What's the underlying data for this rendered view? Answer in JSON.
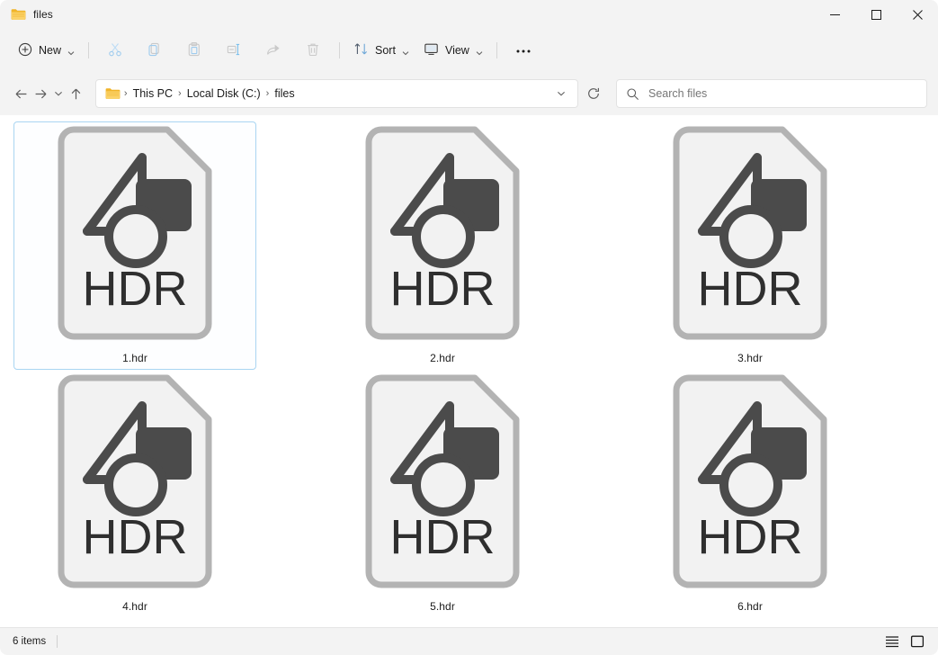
{
  "window": {
    "title": "files",
    "title_icon": "folder-icon",
    "controls": {
      "minimize": "minimize-icon",
      "maximize": "maximize-icon",
      "close": "close-icon"
    }
  },
  "toolbar": {
    "new_label": "New",
    "sort_label": "Sort",
    "view_label": "View",
    "overflow_label": "•••",
    "items": [
      {
        "name": "cut",
        "icon": "scissors-icon",
        "enabled": false
      },
      {
        "name": "copy",
        "icon": "copy-icon",
        "enabled": false
      },
      {
        "name": "paste",
        "icon": "paste-icon",
        "enabled": false
      },
      {
        "name": "rename",
        "icon": "rename-icon",
        "enabled": false
      },
      {
        "name": "share",
        "icon": "share-icon",
        "enabled": false
      },
      {
        "name": "delete",
        "icon": "trash-icon",
        "enabled": false
      }
    ]
  },
  "address": {
    "back": "back-arrow-icon",
    "forward": "forward-arrow-icon",
    "recent": "chevron-down-icon",
    "up": "up-arrow-icon",
    "breadcrumb": [
      "This PC",
      "Local Disk (C:)",
      "files"
    ],
    "separator": "›",
    "dropdown": "chevron-down-icon",
    "refresh": "refresh-icon"
  },
  "search": {
    "placeholder": "Search files",
    "value": "",
    "icon": "search-icon"
  },
  "files": [
    {
      "name": "1.hdr",
      "type_label": "HDR",
      "selected": true
    },
    {
      "name": "2.hdr",
      "type_label": "HDR",
      "selected": false
    },
    {
      "name": "3.hdr",
      "type_label": "HDR",
      "selected": false
    },
    {
      "name": "4.hdr",
      "type_label": "HDR",
      "selected": false
    },
    {
      "name": "5.hdr",
      "type_label": "HDR",
      "selected": false
    },
    {
      "name": "6.hdr",
      "type_label": "HDR",
      "selected": false
    }
  ],
  "status": {
    "item_count": "6 items",
    "view_details": "details-view-icon",
    "view_large_icons": "large-icons-view-icon"
  },
  "colors": {
    "chrome": "#f3f3f3",
    "content": "#ffffff",
    "selection_border": "#a9d5f2",
    "folder_yellow": "#f6c343",
    "icon_glyph": "#4b4b4b",
    "icon_border": "#b3b3b3",
    "icon_fill": "#f2f2f2",
    "disabled_accent": "#a8d5f5"
  }
}
